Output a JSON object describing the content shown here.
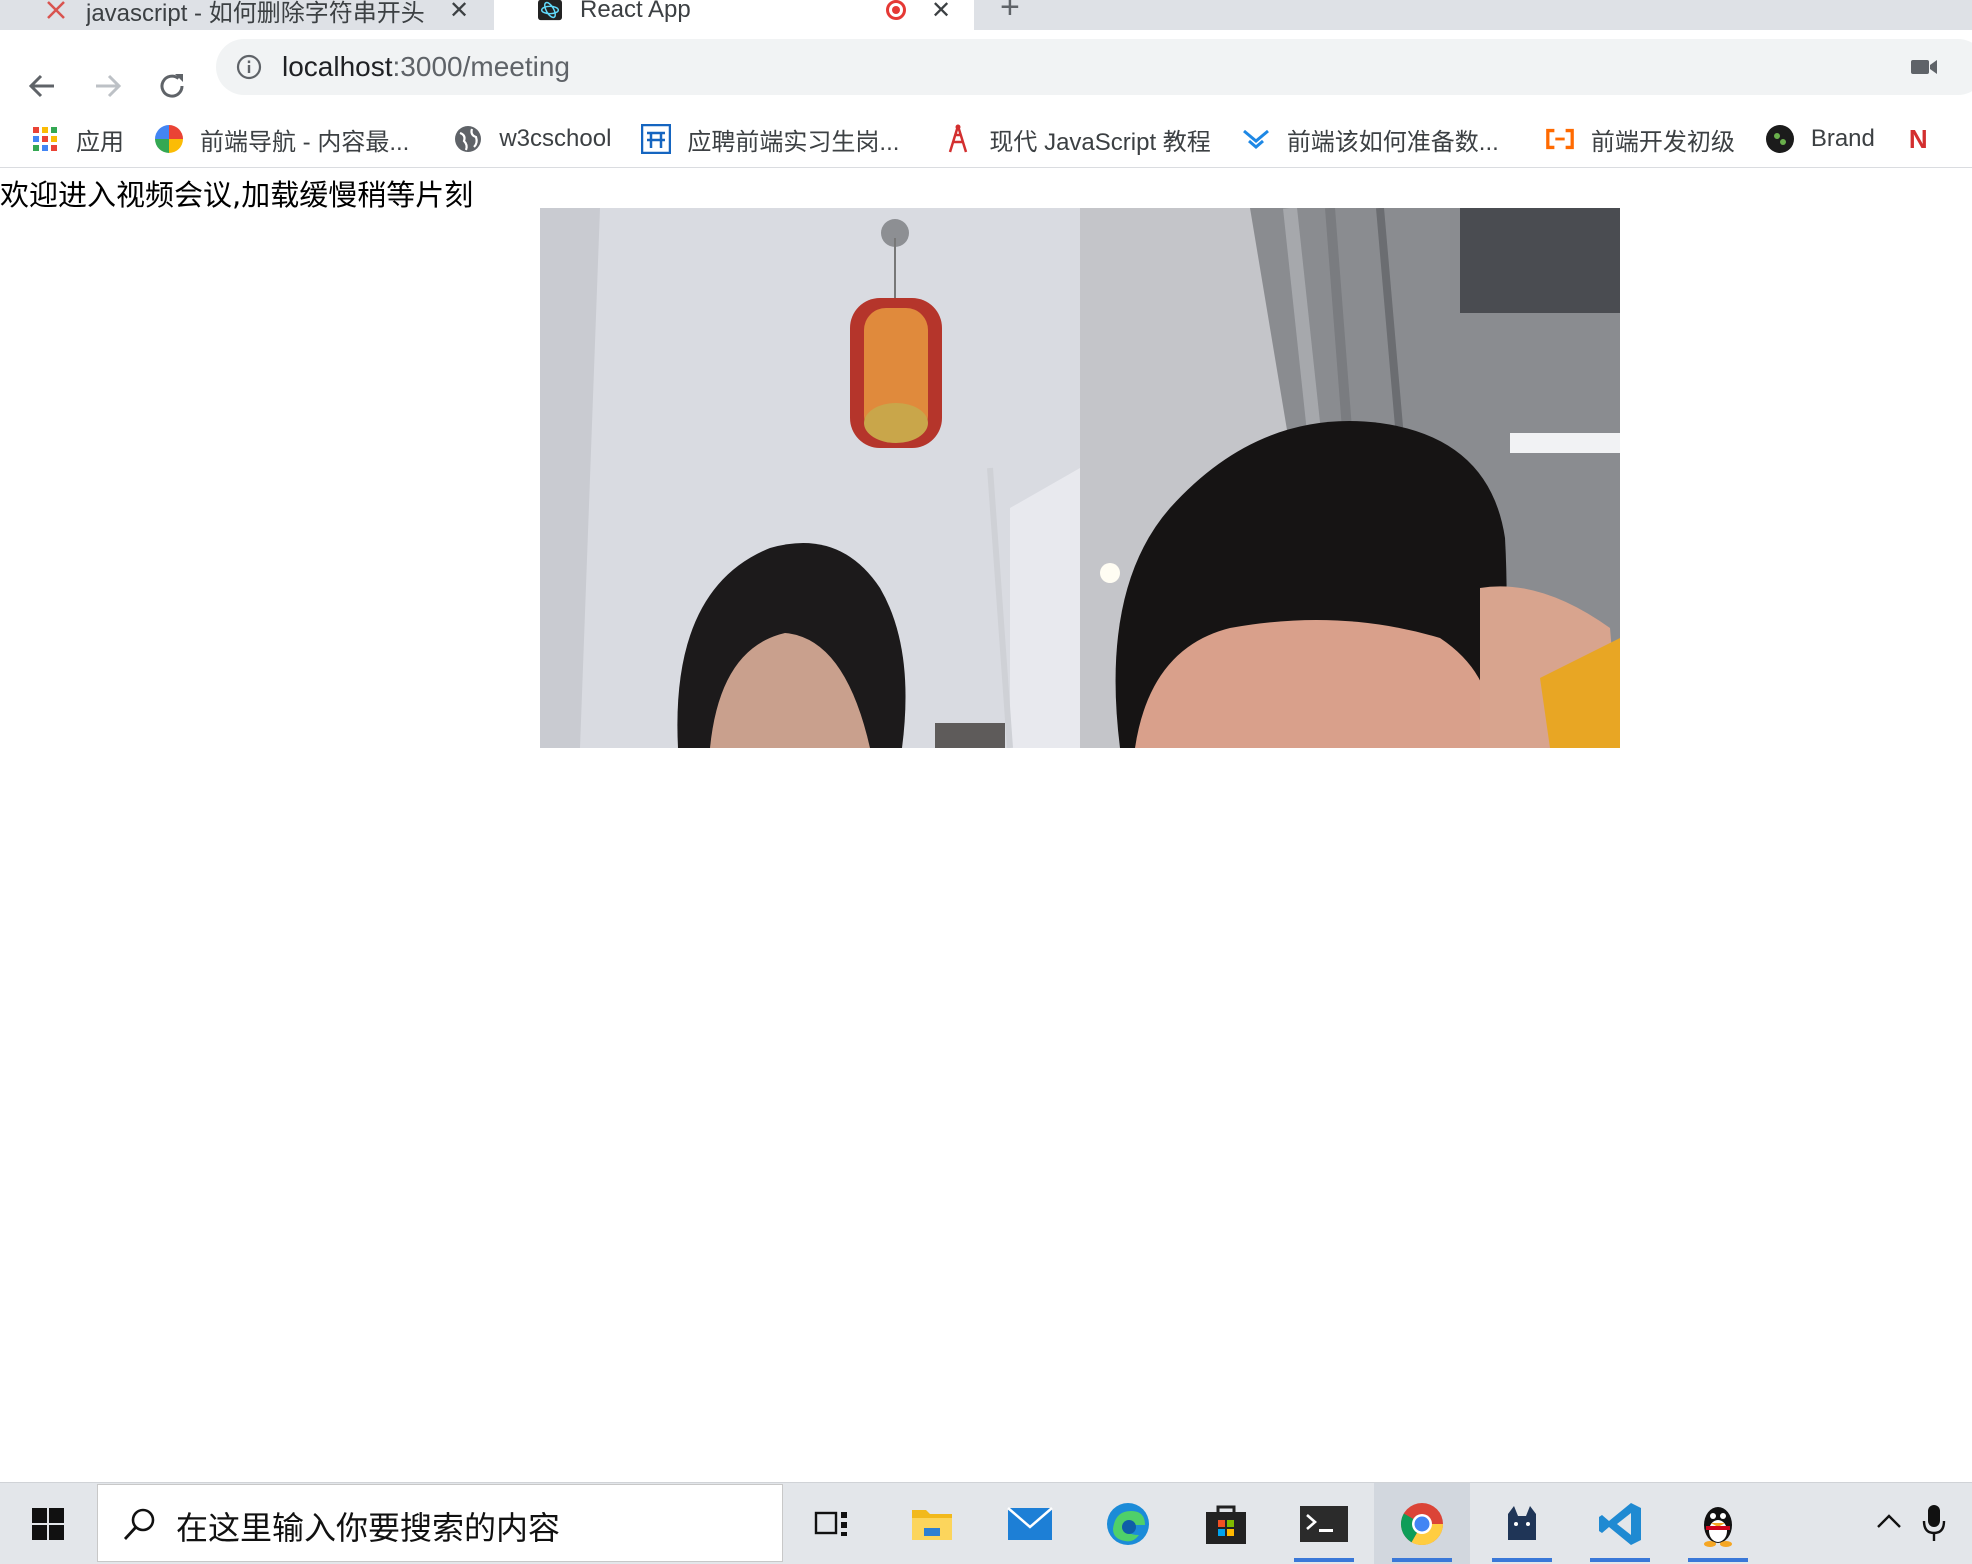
{
  "tabs": [
    {
      "title": "javascript - 如何删除字符串开头",
      "close": "✕"
    },
    {
      "title": "React App",
      "close": "✕"
    }
  ],
  "new_tab": "+",
  "address": {
    "host": "localhost",
    "path": ":3000/meeting"
  },
  "bookmarks": [
    {
      "label": "应用",
      "icon": "apps-grid-icon"
    },
    {
      "label": "前端导航 - 内容最...",
      "icon": "pinwheel-icon"
    },
    {
      "label": "w3cschool",
      "icon": "globe-icon"
    },
    {
      "label": "应聘前端实习生岗...",
      "icon": "site-logo-icon"
    },
    {
      "label": "现代 JavaScript 教程",
      "icon": "tower-icon"
    },
    {
      "label": "前端该如何准备数...",
      "icon": "chevron-logo-icon"
    },
    {
      "label": "前端开发初级",
      "icon": "aliyun-icon"
    },
    {
      "label": "Brand",
      "icon": "brand-icon"
    }
  ],
  "page": {
    "welcome": "欢迎进入视频会议,加载缓慢稍等片刻"
  },
  "taskbar": {
    "search_placeholder": "在这里输入你要搜索的内容",
    "apps": [
      "task-view",
      "file-explorer",
      "mail",
      "edge",
      "store",
      "terminal",
      "chrome",
      "cat-app",
      "vscode",
      "qq"
    ],
    "accent": "#3a78d8"
  }
}
